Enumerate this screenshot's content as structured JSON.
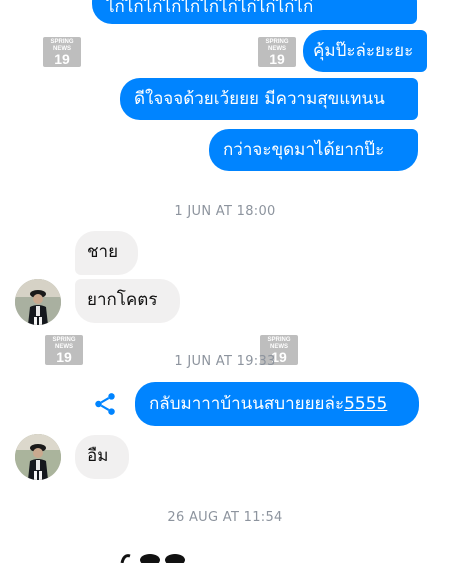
{
  "watermark": {
    "line1": "SPRING",
    "line2": "NEWS",
    "number": "19"
  },
  "messages_top": [
    {
      "id": "m0",
      "text": "ไก่ไก่ไก่ไก่ไก่ไก่ไก่ไก่ไก่ไก่ไก่"
    },
    {
      "id": "m1",
      "text": "คุ้มป๊ะล่ะยะยะ"
    },
    {
      "id": "m2",
      "text": "ดีใจจจด้วยเว้ยยย มีความสุขแทนน"
    },
    {
      "id": "m3",
      "text": "กว่าจะขุดมาได้ยากป๊ะ"
    }
  ],
  "timestamps": {
    "t1": "1 JUN AT 18:00",
    "t2": "1 JUN AT 19:33",
    "t3": "26 AUG AT 11:54"
  },
  "incoming_1": [
    {
      "text": "ชาย"
    },
    {
      "text": "ยากโคตร"
    }
  ],
  "outgoing_link": {
    "prefix": "กลับมาาาบ้านนสบายยยล่ะ",
    "link": "5555"
  },
  "incoming_2": [
    {
      "text": "อืม"
    }
  ],
  "colors": {
    "outgoing": "#0084ff",
    "incoming": "#f1f0f0",
    "timestamp": "#8d949e"
  },
  "icons": {
    "share": "share-icon",
    "avatar": "contact-avatar"
  }
}
